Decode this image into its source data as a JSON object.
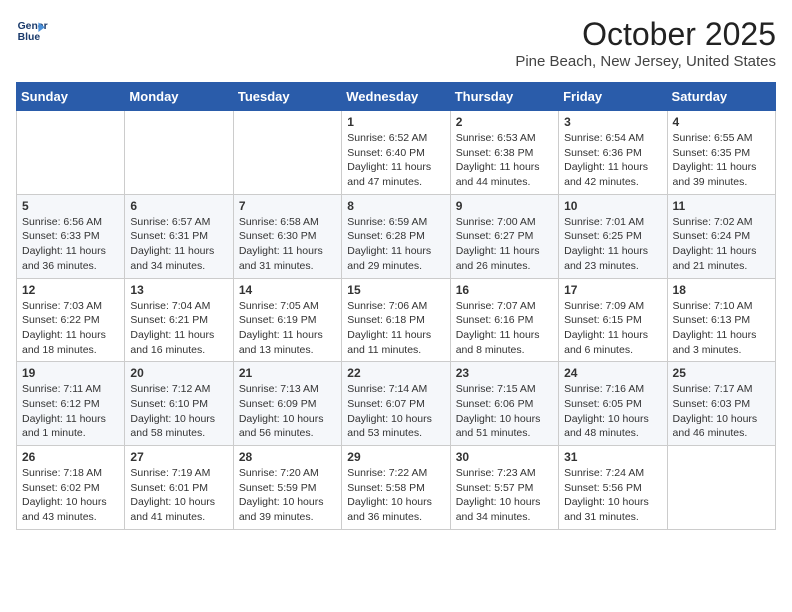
{
  "logo": {
    "line1": "General",
    "line2": "Blue"
  },
  "title": "October 2025",
  "subtitle": "Pine Beach, New Jersey, United States",
  "days_of_week": [
    "Sunday",
    "Monday",
    "Tuesday",
    "Wednesday",
    "Thursday",
    "Friday",
    "Saturday"
  ],
  "weeks": [
    [
      {
        "day": "",
        "info": ""
      },
      {
        "day": "",
        "info": ""
      },
      {
        "day": "",
        "info": ""
      },
      {
        "day": "1",
        "info": "Sunrise: 6:52 AM\nSunset: 6:40 PM\nDaylight: 11 hours and 47 minutes."
      },
      {
        "day": "2",
        "info": "Sunrise: 6:53 AM\nSunset: 6:38 PM\nDaylight: 11 hours and 44 minutes."
      },
      {
        "day": "3",
        "info": "Sunrise: 6:54 AM\nSunset: 6:36 PM\nDaylight: 11 hours and 42 minutes."
      },
      {
        "day": "4",
        "info": "Sunrise: 6:55 AM\nSunset: 6:35 PM\nDaylight: 11 hours and 39 minutes."
      }
    ],
    [
      {
        "day": "5",
        "info": "Sunrise: 6:56 AM\nSunset: 6:33 PM\nDaylight: 11 hours and 36 minutes."
      },
      {
        "day": "6",
        "info": "Sunrise: 6:57 AM\nSunset: 6:31 PM\nDaylight: 11 hours and 34 minutes."
      },
      {
        "day": "7",
        "info": "Sunrise: 6:58 AM\nSunset: 6:30 PM\nDaylight: 11 hours and 31 minutes."
      },
      {
        "day": "8",
        "info": "Sunrise: 6:59 AM\nSunset: 6:28 PM\nDaylight: 11 hours and 29 minutes."
      },
      {
        "day": "9",
        "info": "Sunrise: 7:00 AM\nSunset: 6:27 PM\nDaylight: 11 hours and 26 minutes."
      },
      {
        "day": "10",
        "info": "Sunrise: 7:01 AM\nSunset: 6:25 PM\nDaylight: 11 hours and 23 minutes."
      },
      {
        "day": "11",
        "info": "Sunrise: 7:02 AM\nSunset: 6:24 PM\nDaylight: 11 hours and 21 minutes."
      }
    ],
    [
      {
        "day": "12",
        "info": "Sunrise: 7:03 AM\nSunset: 6:22 PM\nDaylight: 11 hours and 18 minutes."
      },
      {
        "day": "13",
        "info": "Sunrise: 7:04 AM\nSunset: 6:21 PM\nDaylight: 11 hours and 16 minutes."
      },
      {
        "day": "14",
        "info": "Sunrise: 7:05 AM\nSunset: 6:19 PM\nDaylight: 11 hours and 13 minutes."
      },
      {
        "day": "15",
        "info": "Sunrise: 7:06 AM\nSunset: 6:18 PM\nDaylight: 11 hours and 11 minutes."
      },
      {
        "day": "16",
        "info": "Sunrise: 7:07 AM\nSunset: 6:16 PM\nDaylight: 11 hours and 8 minutes."
      },
      {
        "day": "17",
        "info": "Sunrise: 7:09 AM\nSunset: 6:15 PM\nDaylight: 11 hours and 6 minutes."
      },
      {
        "day": "18",
        "info": "Sunrise: 7:10 AM\nSunset: 6:13 PM\nDaylight: 11 hours and 3 minutes."
      }
    ],
    [
      {
        "day": "19",
        "info": "Sunrise: 7:11 AM\nSunset: 6:12 PM\nDaylight: 11 hours and 1 minute."
      },
      {
        "day": "20",
        "info": "Sunrise: 7:12 AM\nSunset: 6:10 PM\nDaylight: 10 hours and 58 minutes."
      },
      {
        "day": "21",
        "info": "Sunrise: 7:13 AM\nSunset: 6:09 PM\nDaylight: 10 hours and 56 minutes."
      },
      {
        "day": "22",
        "info": "Sunrise: 7:14 AM\nSunset: 6:07 PM\nDaylight: 10 hours and 53 minutes."
      },
      {
        "day": "23",
        "info": "Sunrise: 7:15 AM\nSunset: 6:06 PM\nDaylight: 10 hours and 51 minutes."
      },
      {
        "day": "24",
        "info": "Sunrise: 7:16 AM\nSunset: 6:05 PM\nDaylight: 10 hours and 48 minutes."
      },
      {
        "day": "25",
        "info": "Sunrise: 7:17 AM\nSunset: 6:03 PM\nDaylight: 10 hours and 46 minutes."
      }
    ],
    [
      {
        "day": "26",
        "info": "Sunrise: 7:18 AM\nSunset: 6:02 PM\nDaylight: 10 hours and 43 minutes."
      },
      {
        "day": "27",
        "info": "Sunrise: 7:19 AM\nSunset: 6:01 PM\nDaylight: 10 hours and 41 minutes."
      },
      {
        "day": "28",
        "info": "Sunrise: 7:20 AM\nSunset: 5:59 PM\nDaylight: 10 hours and 39 minutes."
      },
      {
        "day": "29",
        "info": "Sunrise: 7:22 AM\nSunset: 5:58 PM\nDaylight: 10 hours and 36 minutes."
      },
      {
        "day": "30",
        "info": "Sunrise: 7:23 AM\nSunset: 5:57 PM\nDaylight: 10 hours and 34 minutes."
      },
      {
        "day": "31",
        "info": "Sunrise: 7:24 AM\nSunset: 5:56 PM\nDaylight: 10 hours and 31 minutes."
      },
      {
        "day": "",
        "info": ""
      }
    ]
  ]
}
